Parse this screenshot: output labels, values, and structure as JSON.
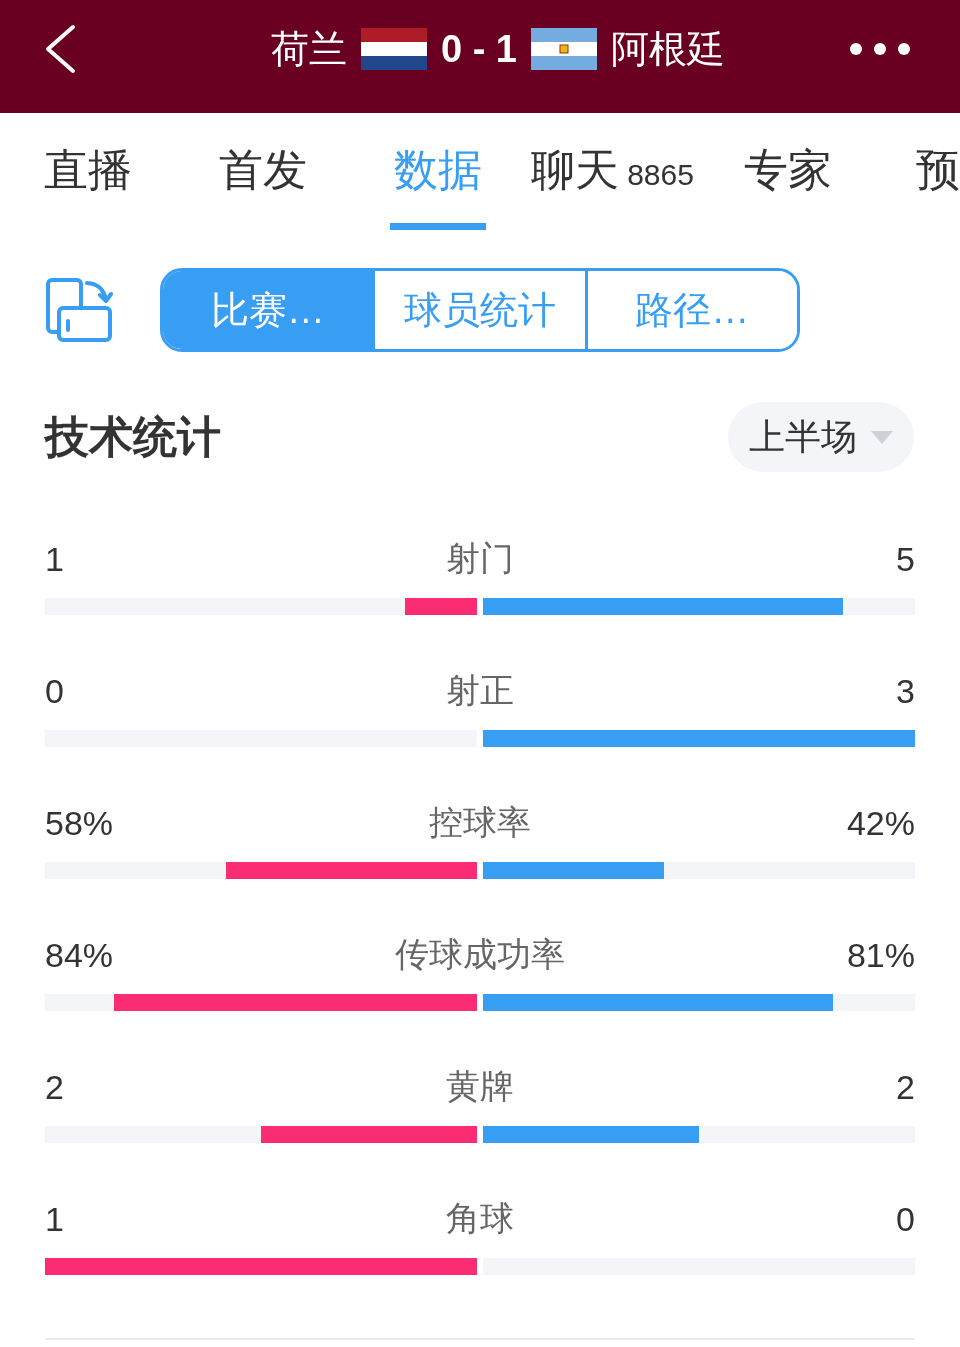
{
  "header": {
    "home_team": "荷兰",
    "score": "0 - 1",
    "away_team": "阿根廷"
  },
  "tabs": [
    {
      "label": "直播",
      "selected": false
    },
    {
      "label": "首发",
      "selected": false
    },
    {
      "label": "数据",
      "selected": true
    },
    {
      "label": "聊天",
      "count": "8865",
      "selected": false
    },
    {
      "label": "专家",
      "selected": false
    },
    {
      "label": "预",
      "selected": false
    }
  ],
  "view_switcher": [
    {
      "label": "比赛…",
      "selected": true
    },
    {
      "label": "球员统计",
      "selected": false
    },
    {
      "label": "路径…",
      "selected": false
    }
  ],
  "stats_section": {
    "title": "技术统计",
    "period": "上半场"
  },
  "stats": [
    {
      "label": "射门",
      "home": {
        "value": "1",
        "level": 0.167
      },
      "away": {
        "value": "5",
        "level": 0.833
      }
    },
    {
      "label": "射正",
      "home": {
        "value": "0",
        "level": 0
      },
      "away": {
        "value": "3",
        "level": 1
      }
    },
    {
      "label": "控球率",
      "home": {
        "value": "58%",
        "level": 0.58
      },
      "away": {
        "value": "42%",
        "level": 0.42
      }
    },
    {
      "label": "传球成功率",
      "home": {
        "value": "84%",
        "level": 0.84
      },
      "away": {
        "value": "81%",
        "level": 0.81
      }
    },
    {
      "label": "黄牌",
      "home": {
        "value": "2",
        "level": 0.5
      },
      "away": {
        "value": "2",
        "level": 0.5
      }
    },
    {
      "label": "角球",
      "home": {
        "value": "1",
        "level": 1
      },
      "away": {
        "value": "0",
        "level": 0
      }
    }
  ]
}
